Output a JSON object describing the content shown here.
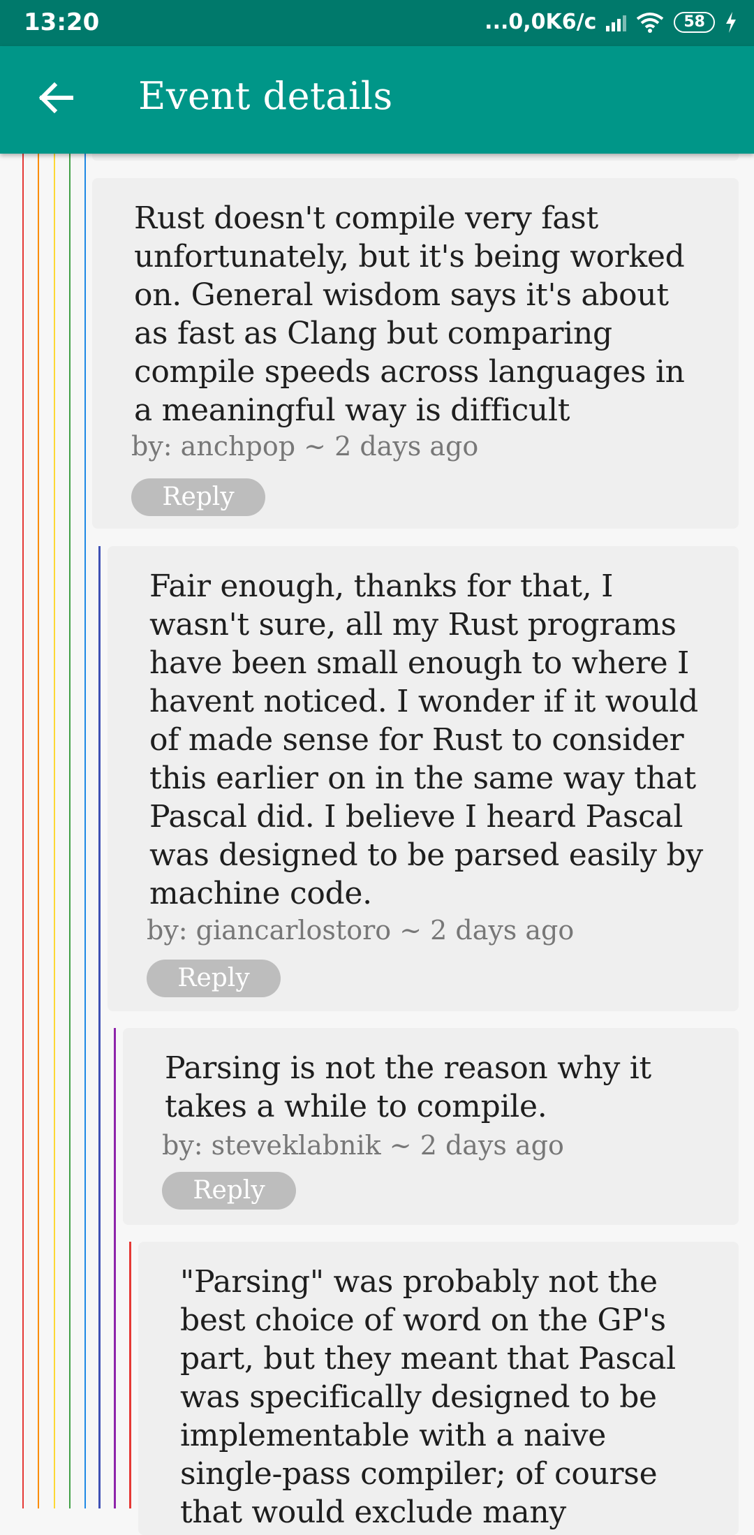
{
  "status_bar": {
    "time": "13:20",
    "network_speed": "...0,0K6/c",
    "battery_level": "58",
    "icons": [
      "signal-icon",
      "wifi-icon",
      "battery-icon",
      "charging-icon"
    ]
  },
  "app_bar": {
    "title": "Event details",
    "back_icon": "arrow-left-icon",
    "color": "#009688"
  },
  "thread_line_colors": [
    "#e53935",
    "#fb8c00",
    "#fdd835",
    "#43a047",
    "#1e88e5"
  ],
  "comments": [
    {
      "text": "Rust doesn't compile very fast unfortunately, but it's being worked on. General wisdom says it's about as fast as Clang but comparing compile speeds across languages in a meaningful way is difficult",
      "meta": "by: anchpop ~ 2 days ago",
      "reply_label": "Reply",
      "depth": 0
    },
    {
      "text": "Fair enough, thanks for that, I wasn't sure, all my Rust programs have been small enough to where I havent noticed. I wonder if it would of made sense for Rust to consider this earlier on in the same way that Pascal did. I believe I heard Pascal was designed to be parsed easily by machine code.",
      "meta": "by: giancarlostoro ~ 2 days ago",
      "reply_label": "Reply",
      "depth": 1,
      "accent": "#3f51b5"
    },
    {
      "text": "Parsing is not the reason why it takes a while to compile.",
      "meta": "by: steveklabnik ~ 2 days ago",
      "reply_label": "Reply",
      "depth": 2,
      "accent": "#8e24aa"
    },
    {
      "text": "\"Parsing\" was probably not the best choice of word on the GP's part, but they meant that Pascal was specifically designed to be implementable with a naive single-pass compiler; of course that would exclude many",
      "depth": 3,
      "accent": "#e53935"
    }
  ]
}
